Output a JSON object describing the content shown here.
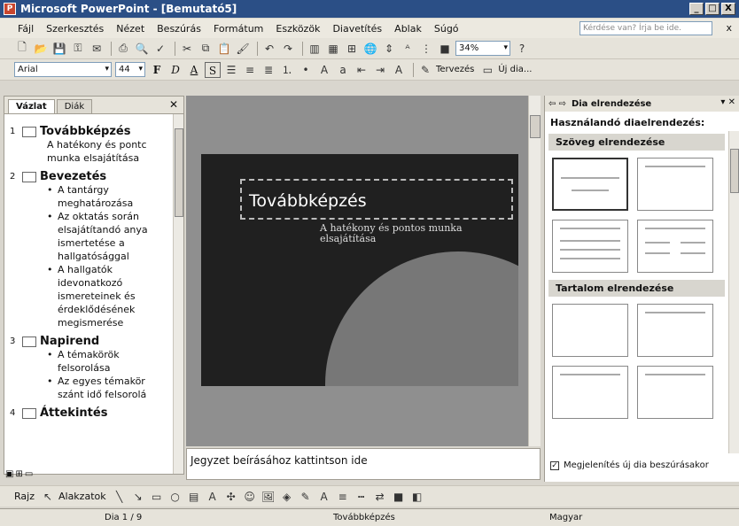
{
  "window": {
    "title": "Microsoft PowerPoint - [Bemutató5]",
    "buttons": [
      "_",
      "□",
      "X"
    ]
  },
  "menu": {
    "items": [
      "Fájl",
      "Szerkesztés",
      "Nézet",
      "Beszúrás",
      "Formátum",
      "Eszközök",
      "Diavetítés",
      "Ablak",
      "Súgó"
    ],
    "help_placeholder": "Kérdése van? Írja be ide.",
    "close": "x"
  },
  "toolbar": {
    "zoom": "34%",
    "font_name": "Arial",
    "font_size": "44",
    "format_letters": [
      "F",
      "D",
      "A",
      "S"
    ],
    "design_label": "Tervezés",
    "new_slide_label": "Új dia..."
  },
  "outline": {
    "tabs": [
      "Vázlat",
      "Diák"
    ],
    "slides": [
      {
        "num": "1",
        "title": "Továbbképzés",
        "subtitle": [
          "A hatékony és pontc",
          "munka elsajátítása"
        ]
      },
      {
        "num": "2",
        "title": "Bevezetés",
        "bullets": [
          [
            "A tantárgy",
            "meghatározása"
          ],
          [
            "Az oktatás során",
            "elsajátítandó anya",
            "ismertetése a",
            "hallgatósággal"
          ],
          [
            "A hallgatók",
            "idevonatkozó",
            "ismereteinek és",
            "érdeklődésének",
            "megismerése"
          ]
        ]
      },
      {
        "num": "3",
        "title": "Napirend",
        "bullets": [
          [
            "A témakörök",
            "felsorolása"
          ],
          [
            "Az egyes témakör",
            "szánt idő felsorolá"
          ]
        ]
      },
      {
        "num": "4",
        "title": "Áttekintés"
      }
    ]
  },
  "slide": {
    "title": "Továbbképzés",
    "subtitle_line1": "A hatékony és pontos munka",
    "subtitle_line2": "elsajátítása"
  },
  "notes": {
    "placeholder": "Jegyzet beírásához kattintson ide"
  },
  "taskpane": {
    "title": "Dia elrendezése",
    "subtitle": "Használandó diaelrendezés:",
    "section_text": "Szöveg elrendezése",
    "section_content": "Tartalom elrendezése",
    "checkbox_label": "Megjelenítés új dia beszúrásakor",
    "checkbox_checked": true
  },
  "drawing": {
    "draw_label": "Rajz",
    "shapes_label": "Alakzatok"
  },
  "status": {
    "slide": "Dia 1 / 9",
    "design": "Továbbképzés",
    "language": "Magyar"
  }
}
